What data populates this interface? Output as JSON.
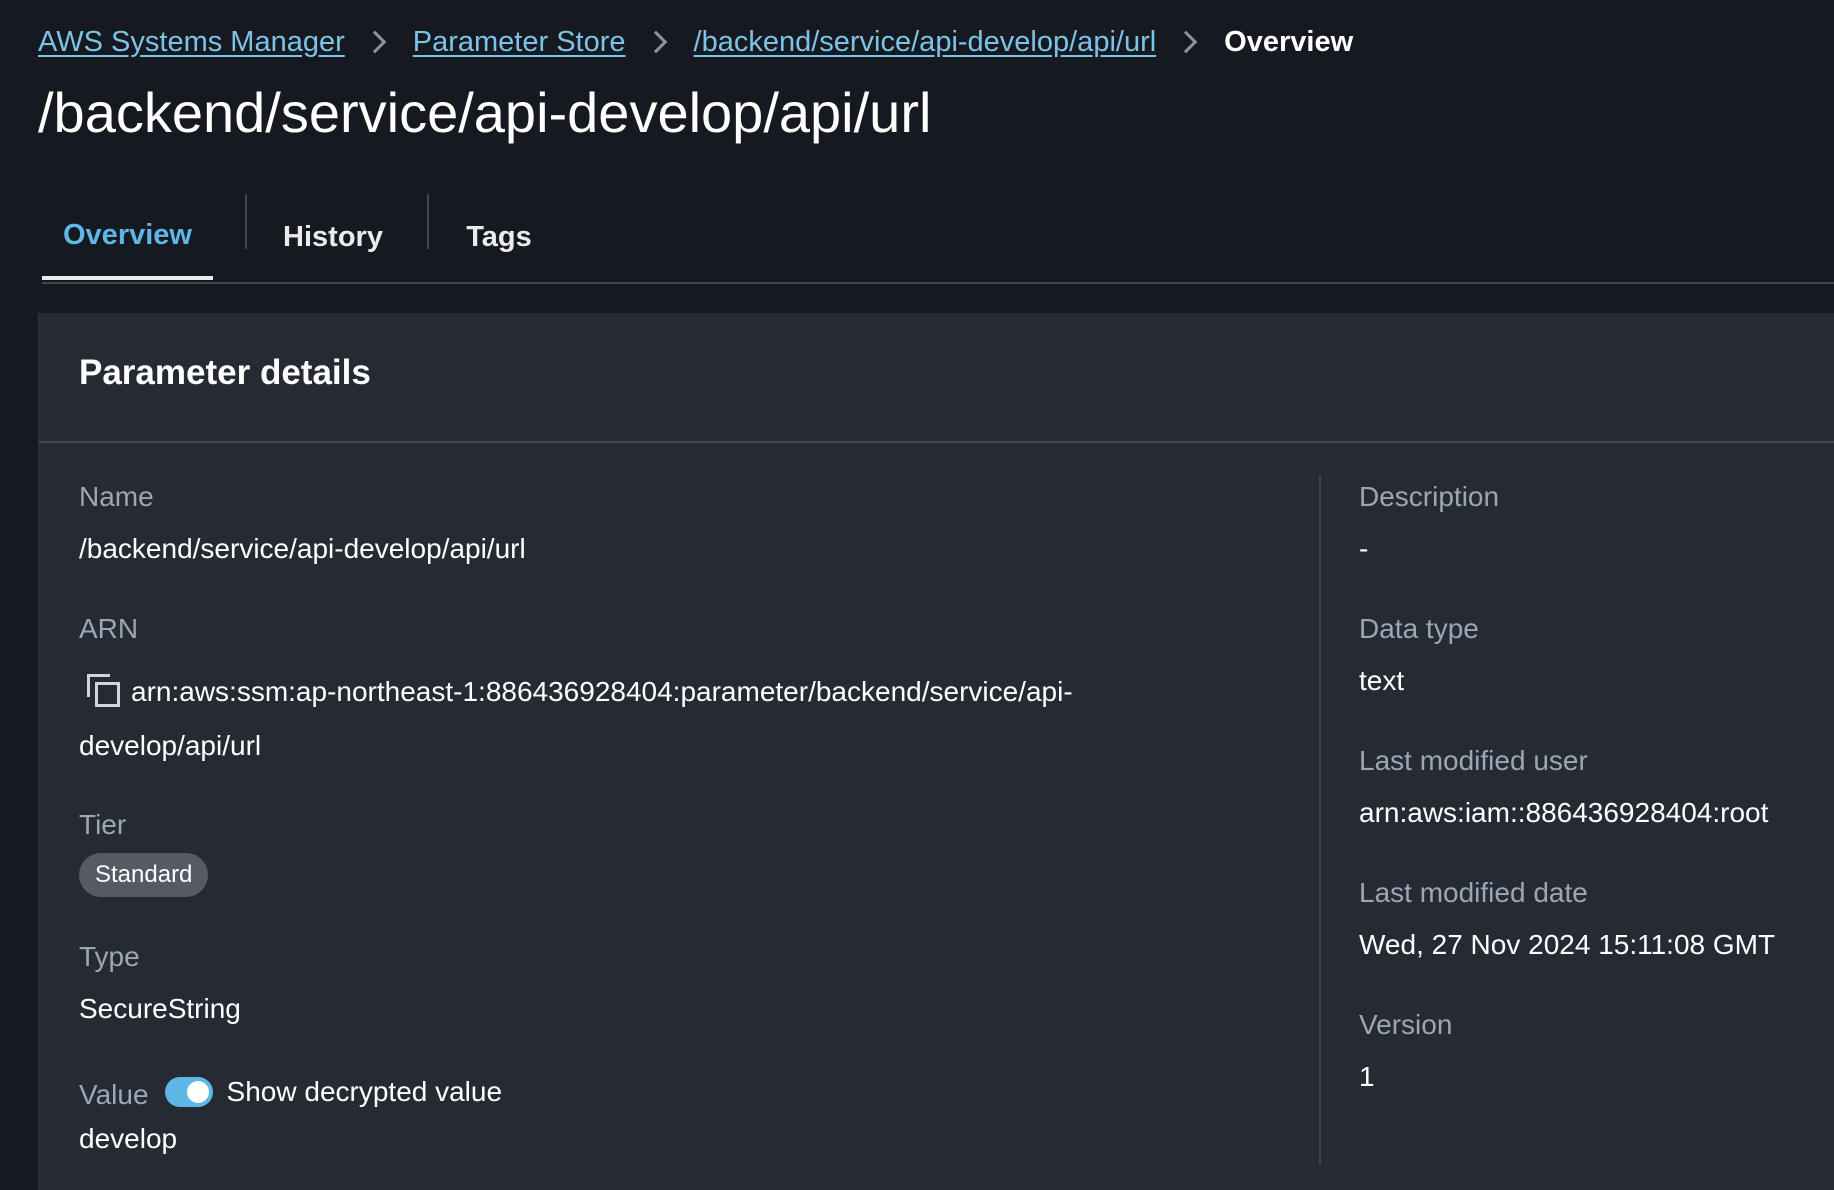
{
  "breadcrumb": {
    "items": [
      "AWS Systems Manager",
      "Parameter Store",
      "/backend/service/api-develop/api/url"
    ],
    "current": "Overview"
  },
  "page_title": "/backend/service/api-develop/api/url",
  "tabs": [
    {
      "label": "Overview",
      "active": true
    },
    {
      "label": "History",
      "active": false
    },
    {
      "label": "Tags",
      "active": false
    }
  ],
  "panel": {
    "title": "Parameter details",
    "left": {
      "name": {
        "label": "Name",
        "value": "/backend/service/api-develop/api/url"
      },
      "arn": {
        "label": "ARN",
        "value": "arn:aws:ssm:ap-northeast-1:886436928404:parameter/backend/service/api-develop/api/url"
      },
      "tier": {
        "label": "Tier",
        "value": "Standard"
      },
      "type": {
        "label": "Type",
        "value": "SecureString"
      },
      "value": {
        "label": "Value",
        "toggle_label": "Show decrypted value",
        "toggle_on": true,
        "value": "develop"
      }
    },
    "right": {
      "description": {
        "label": "Description",
        "value": "-"
      },
      "data_type": {
        "label": "Data type",
        "value": "text"
      },
      "last_modified_user": {
        "label": "Last modified user",
        "value": "arn:aws:iam::886436928404:root"
      },
      "last_modified_date": {
        "label": "Last modified date",
        "value": "Wed, 27 Nov 2024 15:11:08 GMT"
      },
      "version": {
        "label": "Version",
        "value": "1"
      }
    }
  },
  "colors": {
    "background": "#16191f",
    "panel": "#262a32",
    "link": "#7cc3e8",
    "active_tab": "#5fb7e5",
    "toggle": "#5fb7e5",
    "badge": "#545b64"
  },
  "icons": {
    "copy": "copy-icon",
    "breadcrumb_separator": "chevron-right-icon"
  }
}
